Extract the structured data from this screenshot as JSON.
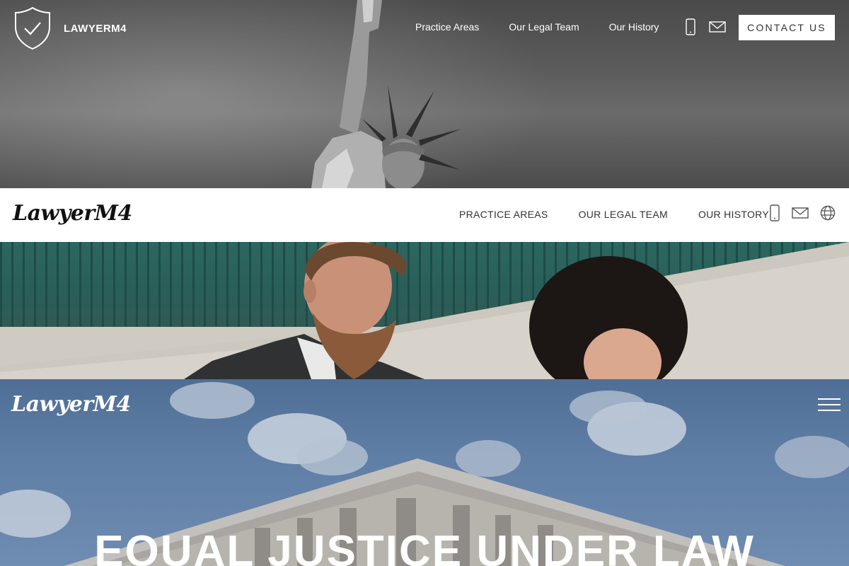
{
  "header_dark": {
    "brand": "LAWYERM4",
    "nav": [
      "Practice Areas",
      "Our Legal Team",
      "Our History"
    ],
    "icons": [
      "phone-icon",
      "mail-icon"
    ],
    "contact_label": "CONTACT US"
  },
  "header_light": {
    "brand": "LawyerM4",
    "nav": [
      "PRACTICE AREAS",
      "OUR LEGAL TEAM",
      "OUR HISTORY"
    ],
    "icons": [
      "phone-icon",
      "mail-icon",
      "globe-icon"
    ]
  },
  "hero": {
    "brand": "LawyerM4",
    "headline": "EQUAL JUSTICE UNDER LAW",
    "menu_icon": "hamburger-icon"
  },
  "colors": {
    "header_dark_bg": "#4a4a4a",
    "header_light_bg": "#ffffff",
    "fence_green": "#2a5e58",
    "sky_blue": "#5f7ea5"
  }
}
